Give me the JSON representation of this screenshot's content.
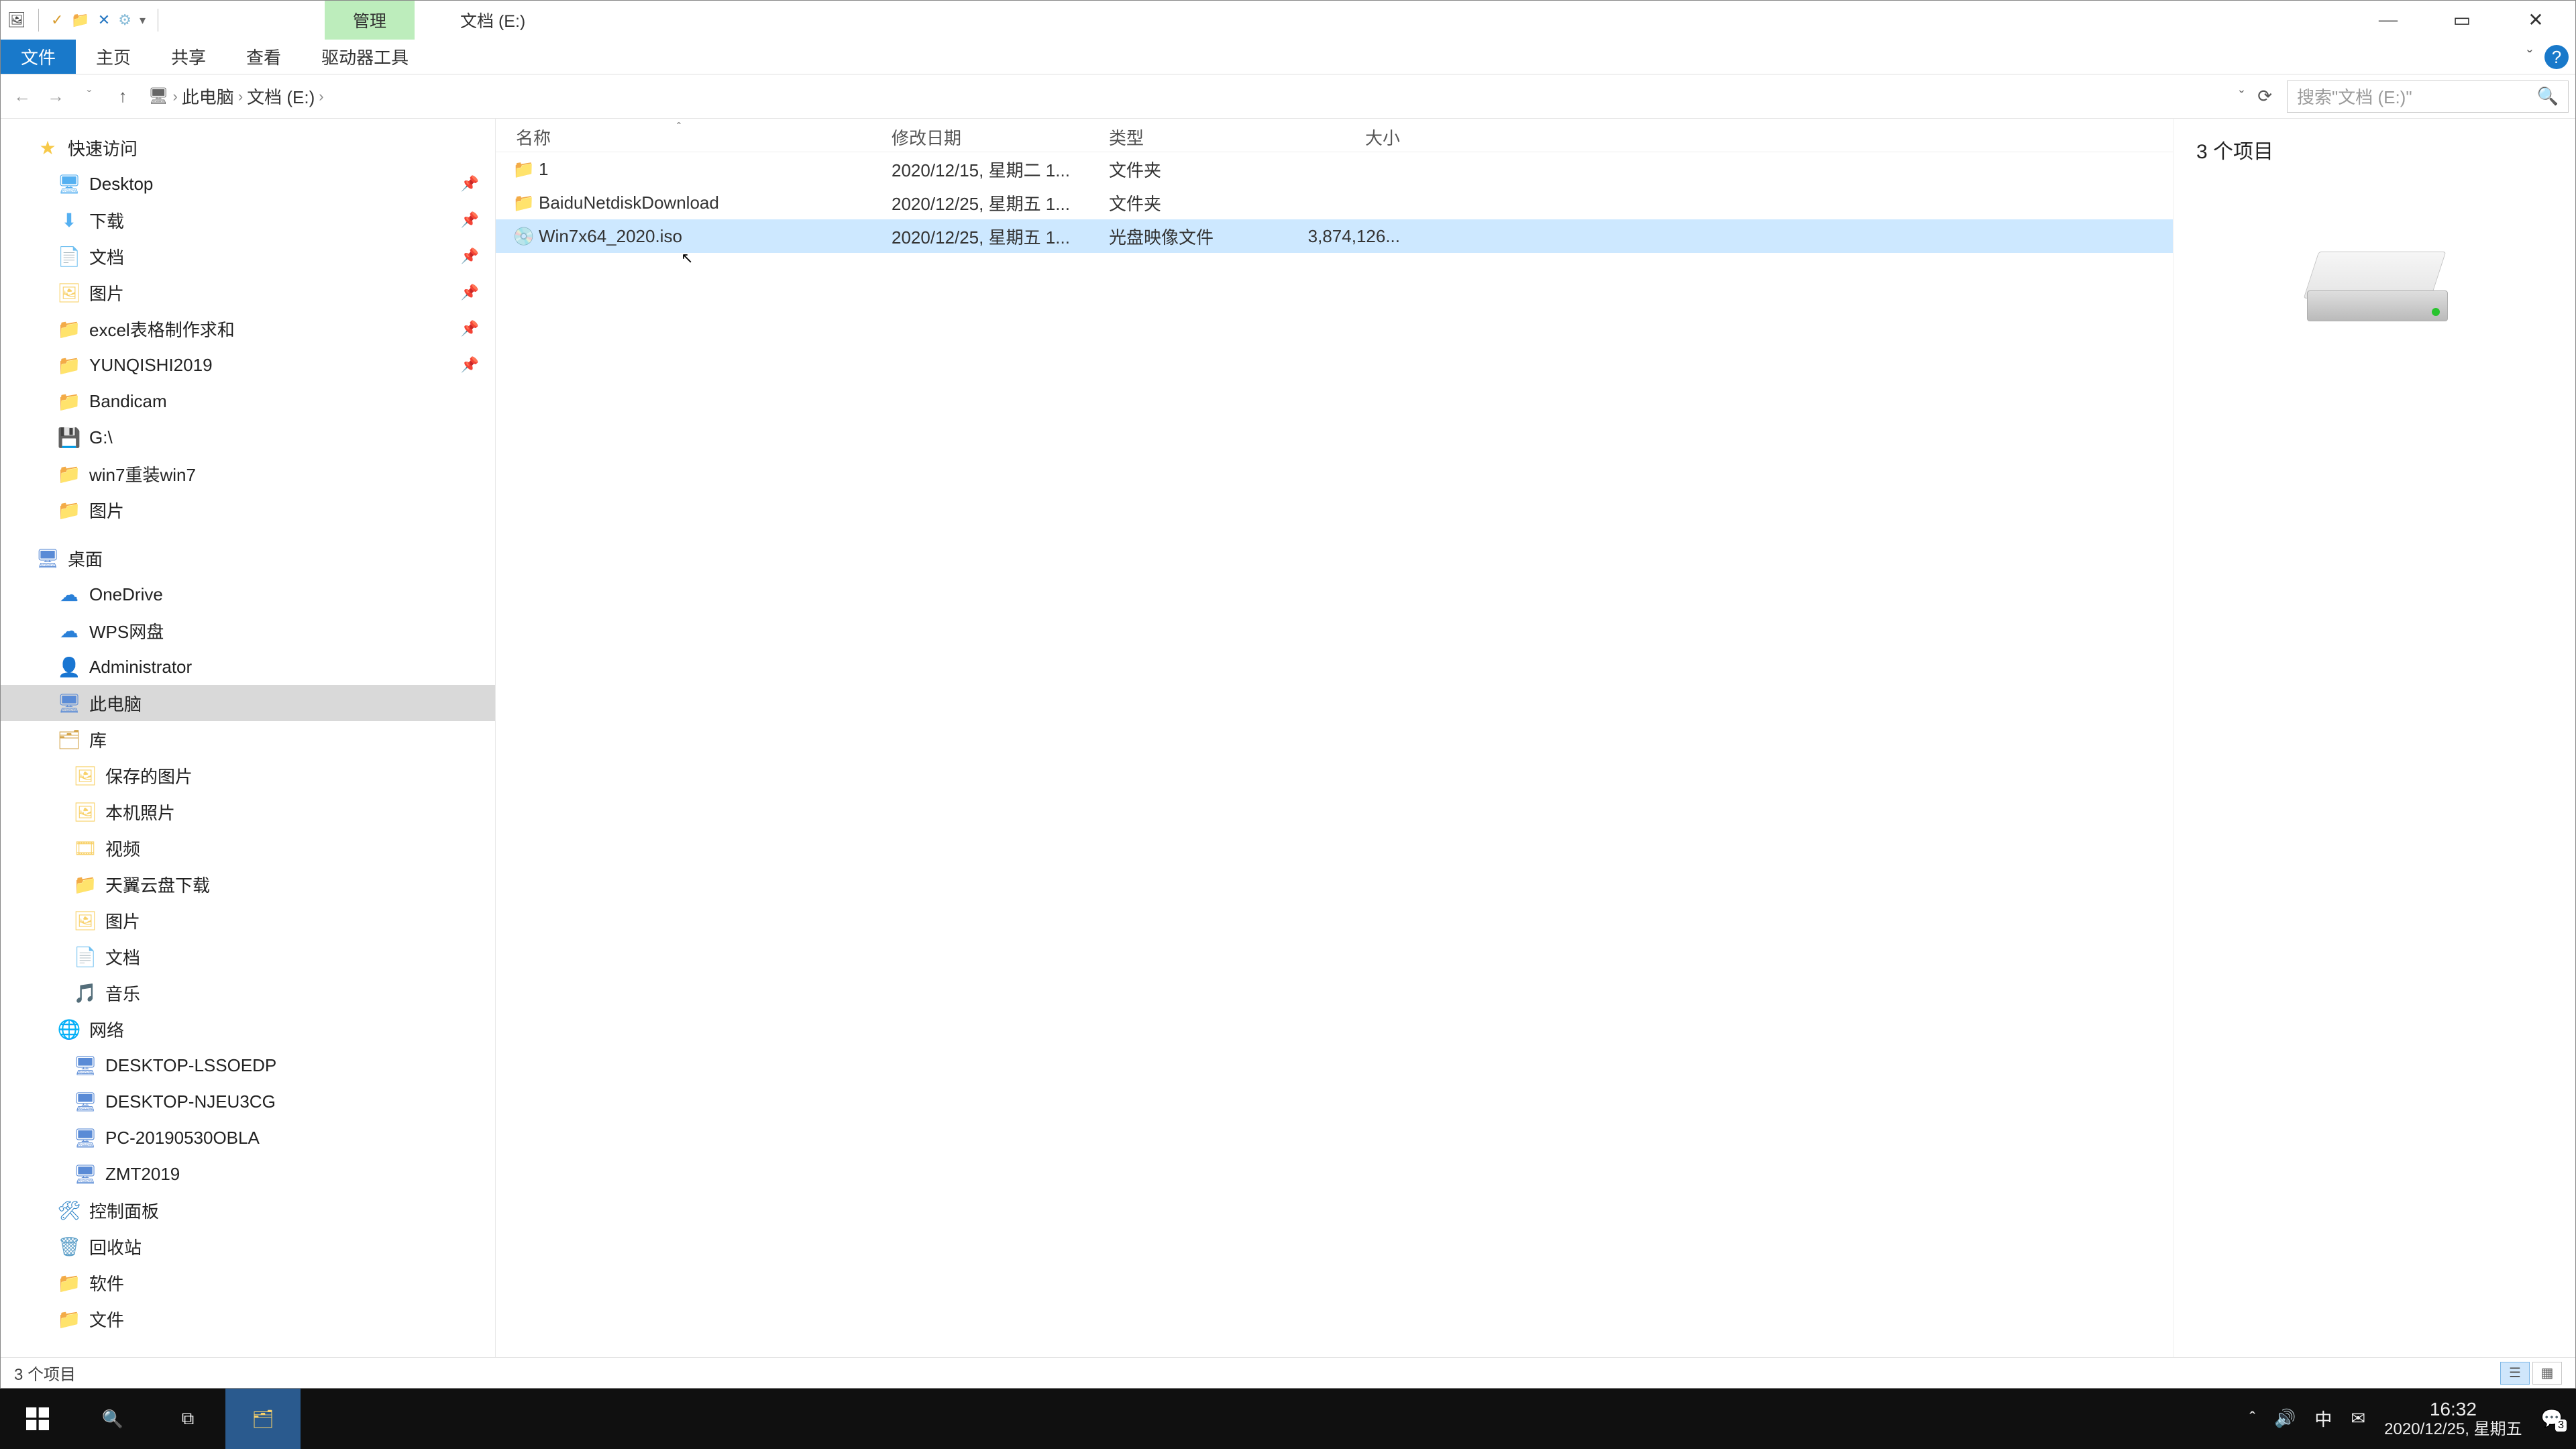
{
  "titlebar": {
    "context_tab": "管理",
    "title": "文档 (E:)",
    "min_glyph": "—",
    "max_glyph": "▭",
    "close_glyph": "✕"
  },
  "ribbon": {
    "file": "文件",
    "home": "主页",
    "share": "共享",
    "view": "查看",
    "drive": "驱动器工具",
    "caret": "ˇ",
    "help": "?"
  },
  "addr": {
    "back": "←",
    "fwd": "→",
    "dd": "ˇ",
    "up": "↑",
    "pc_glyph": "🖥",
    "sep": "›",
    "pc": "此电脑",
    "loc": "文档 (E:)",
    "refresh": "⟳",
    "search_placeholder": "搜索\"文档 (E:)\"",
    "search_icon": "🔍"
  },
  "nav": {
    "quick": "快速访问",
    "desktop": "Desktop",
    "downloads": "下载",
    "docs": "文档",
    "pics": "图片",
    "excel": "excel表格制作求和",
    "yunqishi": "YUNQISHI2019",
    "bandicam": "Bandicam",
    "gdrive": "G:\\",
    "win7": "win7重装win7",
    "pics2": "图片",
    "desk": "桌面",
    "onedrive": "OneDrive",
    "wps": "WPS网盘",
    "admin": "Administrator",
    "thispc": "此电脑",
    "lib": "库",
    "savedpic": "保存的图片",
    "localpic": "本机照片",
    "video": "视频",
    "tianyi": "天翼云盘下载",
    "pic3": "图片",
    "doc3": "文档",
    "music": "音乐",
    "network": "网络",
    "pc1": "DESKTOP-LSSOEDP",
    "pc2": "DESKTOP-NJEU3CG",
    "pc3": "PC-20190530OBLA",
    "pc4": "ZMT2019",
    "ctrl": "控制面板",
    "bin": "回收站",
    "soft": "软件",
    "file": "文件"
  },
  "cols": {
    "name": "名称",
    "date": "修改日期",
    "type": "类型",
    "size": "大小",
    "sort": "ˆ"
  },
  "files": [
    {
      "icon": "📁",
      "name": "1",
      "date": "2020/12/15, 星期二 1...",
      "type": "文件夹",
      "size": ""
    },
    {
      "icon": "📁",
      "name": "BaiduNetdiskDownload",
      "date": "2020/12/25, 星期五 1...",
      "type": "文件夹",
      "size": ""
    },
    {
      "icon": "💿",
      "name": "Win7x64_2020.iso",
      "date": "2020/12/25, 星期五 1...",
      "type": "光盘映像文件",
      "size": "3,874,126..."
    }
  ],
  "preview": {
    "title": "3 个项目"
  },
  "status": {
    "text": "3 个项目"
  },
  "taskbar": {
    "time": "16:32",
    "date": "2020/12/25, 星期五",
    "ime": "中",
    "up": "ˆ",
    "snd": "🔊",
    "badge": "3"
  }
}
